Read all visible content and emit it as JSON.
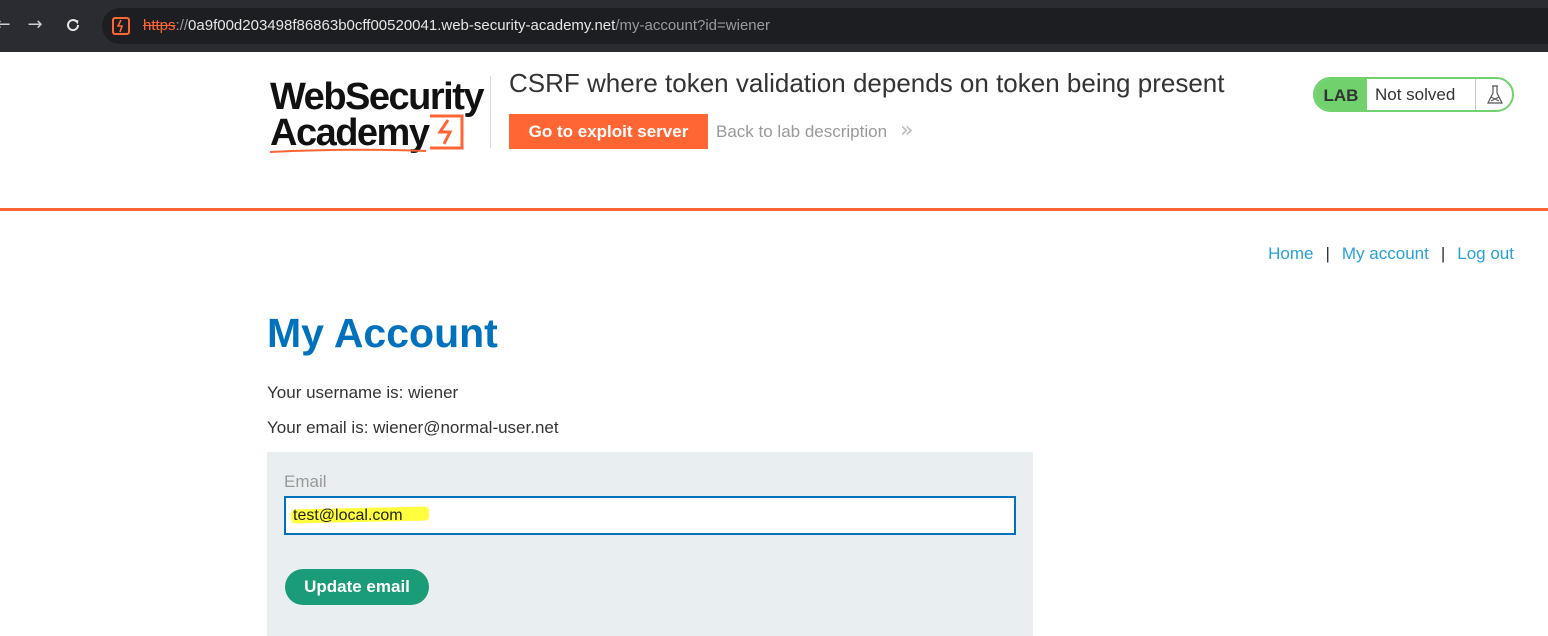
{
  "browser": {
    "url_scheme": "https",
    "url_sep": "://",
    "url_host": "0a9f00d203498f86863b0cff00520041.web-security-academy.net",
    "url_path": "/my-account?id=wiener",
    "back_icon": "arrow-left-icon",
    "forward_icon": "arrow-right-icon",
    "reload_icon": "reload-icon"
  },
  "header": {
    "logo_line1": "WebSecurity",
    "logo_line2": "Academy",
    "lab_title": "CSRF where token validation depends on token being present",
    "exploit_button": "Go to exploit server",
    "back_link": "Back to lab description",
    "lab_badge": "LAB",
    "lab_state": "Not solved"
  },
  "nav": {
    "home": "Home",
    "separator": "|",
    "my_account": "My account",
    "log_out": "Log out"
  },
  "main": {
    "title": "My Account",
    "username_line": "Your username is: wiener",
    "email_line": "Your email is: wiener@normal-user.net",
    "email_label": "Email",
    "email_value": "test@local.com",
    "update_button": "Update email"
  },
  "colors": {
    "brand_orange": "#ff6633",
    "link_blue": "#0071bc",
    "lab_green": "#70d16d",
    "button_green": "#1b9c78",
    "highlight_yellow": "#ffff33"
  }
}
